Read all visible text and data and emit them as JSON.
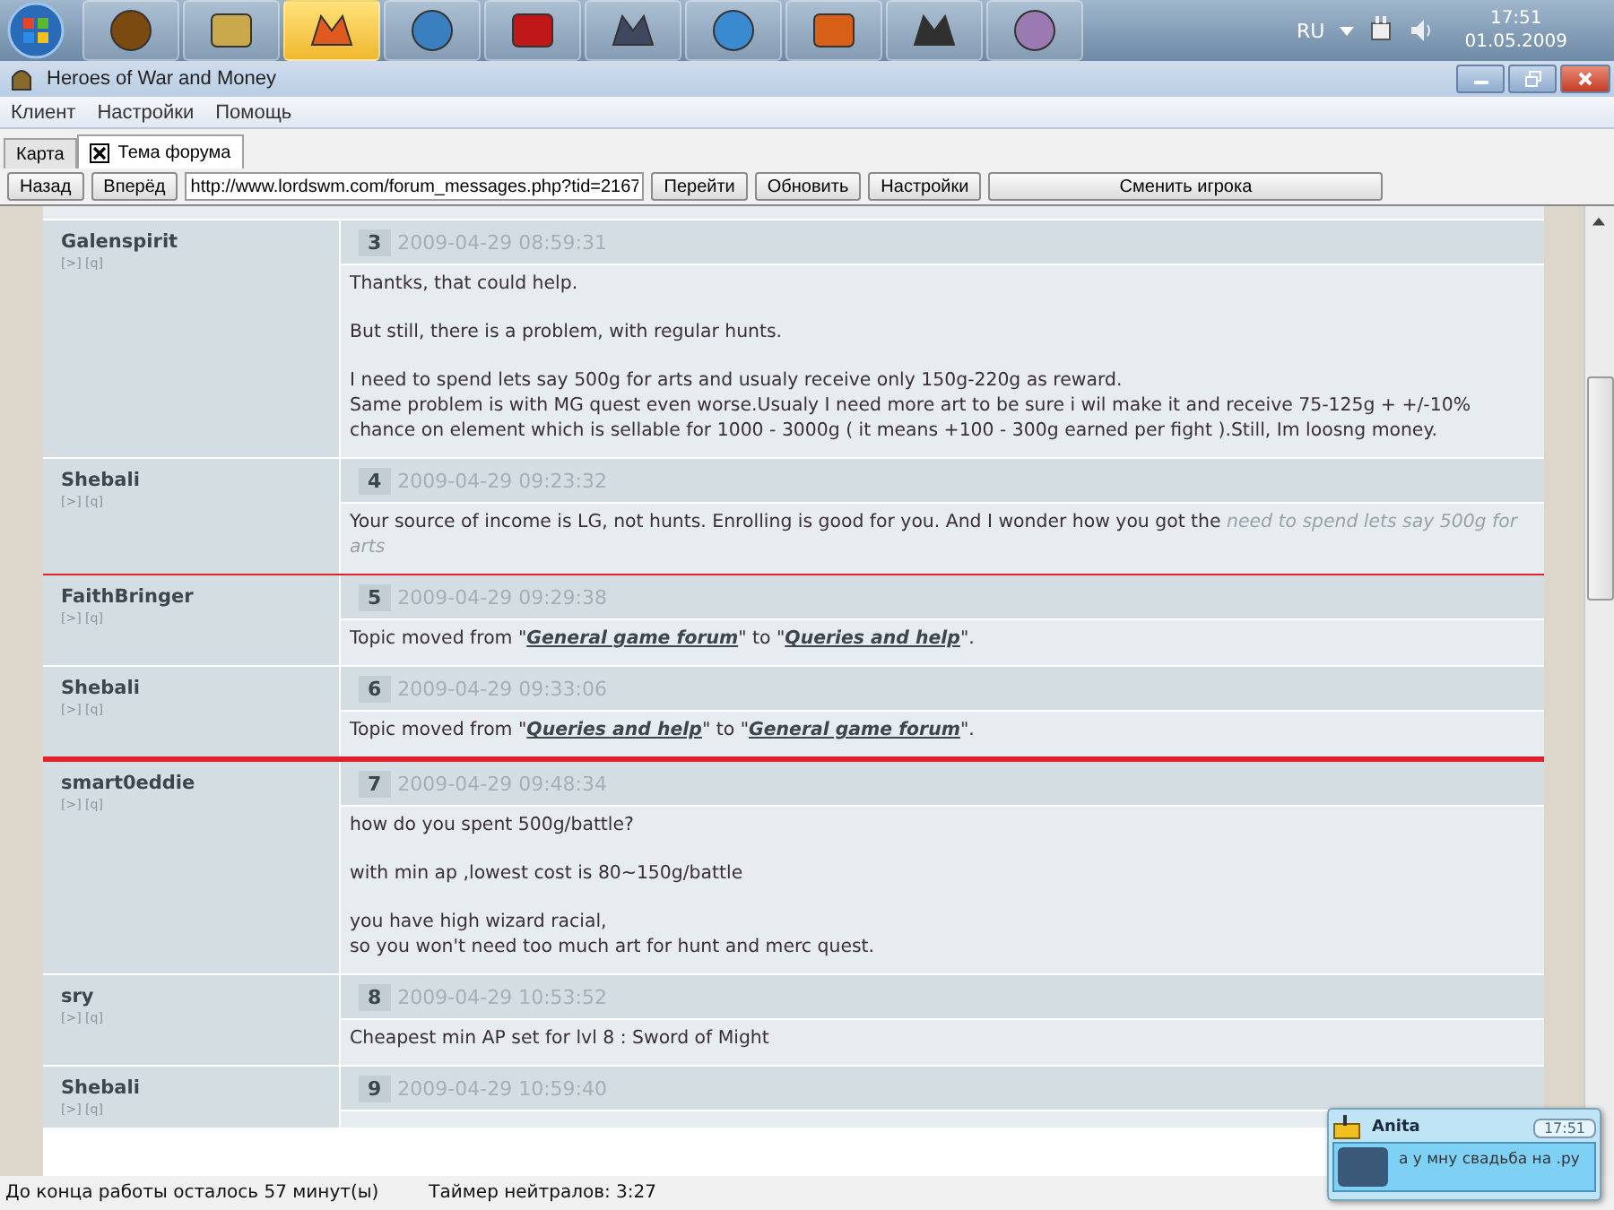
{
  "taskbar": {
    "apps": [
      {
        "selected": false
      },
      {
        "selected": false
      },
      {
        "selected": true
      },
      {
        "selected": false
      },
      {
        "selected": false
      },
      {
        "selected": false
      },
      {
        "selected": false
      },
      {
        "selected": false
      },
      {
        "selected": false
      },
      {
        "selected": false
      }
    ],
    "tray": {
      "language": "RU",
      "time": "17:51",
      "date": "01.05.2009"
    }
  },
  "window": {
    "title": "Heroes of War and Money"
  },
  "menu": [
    "Клиент",
    "Настройки",
    "Помощь"
  ],
  "tabs": [
    {
      "label": "Карта",
      "selected": false,
      "closable": false
    },
    {
      "label": "Тема форума",
      "selected": true,
      "closable": true
    }
  ],
  "toolbar": {
    "back": "Назад",
    "forward": "Вперёд",
    "url": "http://www.lordswm.com/forum_messages.php?tid=2167",
    "buttons": [
      "Перейти",
      "Обновить",
      "Настройки",
      "Сменить игрока"
    ]
  },
  "posts": [
    {
      "author": "Galenspirit",
      "links": "[>] [q]",
      "number": "3",
      "date": "2009-04-29 08:59:31",
      "highlighted": false,
      "paragraphs": [
        [
          {
            "kind": "text",
            "text": "Thantks, that could help."
          }
        ],
        [
          {
            "kind": "text",
            "text": "But still, there is a problem, with regular hunts."
          }
        ],
        [
          {
            "kind": "text",
            "text": "I need to spend lets say 500g for arts and usualy receive only 150g-220g as reward."
          },
          {
            "kind": "break"
          },
          {
            "kind": "text",
            "text": "Same problem is with MG quest even worse.Usualy I need more art to be sure i wil make it and receive 75-125g + +/-10% chance on element which is sellable for 1000 - 3000g ( it means +100 - 300g earned per fight ).Still, Im loosng money."
          }
        ]
      ]
    },
    {
      "author": "Shebali",
      "links": "[>] [q]",
      "number": "4",
      "date": "2009-04-29 09:23:32",
      "highlighted": false,
      "paragraphs": [
        [
          {
            "kind": "text",
            "text": "Your source of income is LG, not hunts. Enrolling is good for you. And I wonder how you got the "
          },
          {
            "kind": "quote",
            "text": "need to spend lets say 500g for arts"
          }
        ]
      ]
    },
    {
      "author": "FaithBringer",
      "links": "[>] [q]",
      "number": "5",
      "date": "2009-04-29 09:29:38",
      "highlighted": true,
      "paragraphs": [
        [
          {
            "kind": "text",
            "text": "Topic moved from \""
          },
          {
            "kind": "link",
            "text": "General game forum"
          },
          {
            "kind": "text",
            "text": "\" to \""
          },
          {
            "kind": "link",
            "text": "Queries and help"
          },
          {
            "kind": "text",
            "text": "\"."
          }
        ]
      ]
    },
    {
      "author": "Shebali",
      "links": "[>] [q]",
      "number": "6",
      "date": "2009-04-29 09:33:06",
      "highlighted": true,
      "paragraphs": [
        [
          {
            "kind": "text",
            "text": "Topic moved from \""
          },
          {
            "kind": "link",
            "text": "Queries and help"
          },
          {
            "kind": "text",
            "text": "\" to \""
          },
          {
            "kind": "link",
            "text": "General game forum"
          },
          {
            "kind": "text",
            "text": "\"."
          }
        ]
      ]
    },
    {
      "author": "smart0eddie",
      "links": "[>] [q]",
      "number": "7",
      "date": "2009-04-29 09:48:34",
      "highlighted": false,
      "paragraphs": [
        [
          {
            "kind": "text",
            "text": "how do you spent 500g/battle?"
          }
        ],
        [
          {
            "kind": "text",
            "text": "with min ap ,lowest cost is 80~150g/battle"
          }
        ],
        [
          {
            "kind": "text",
            "text": "you have high wizard racial,"
          },
          {
            "kind": "break"
          },
          {
            "kind": "text",
            "text": "so you won't need too much art for hunt and merc quest."
          }
        ]
      ]
    },
    {
      "author": "sry",
      "links": "[>] [q]",
      "number": "8",
      "date": "2009-04-29 10:53:52",
      "highlighted": false,
      "paragraphs": [
        [
          {
            "kind": "text",
            "text": "Cheapest min AP set for lvl 8 : Sword of Might"
          }
        ]
      ]
    },
    {
      "author": "Shebali",
      "links": "[>] [q]",
      "number": "9",
      "date": "2009-04-29 10:59:40",
      "highlighted": false
    }
  ],
  "status_bar": [
    "До конца работы осталось 57 минут(ы)",
    "Таймер нейтралов: 3:27"
  ],
  "notification": {
    "sender": "Anita",
    "time": "17:51",
    "message": "а у мну свадьба на .ру"
  }
}
